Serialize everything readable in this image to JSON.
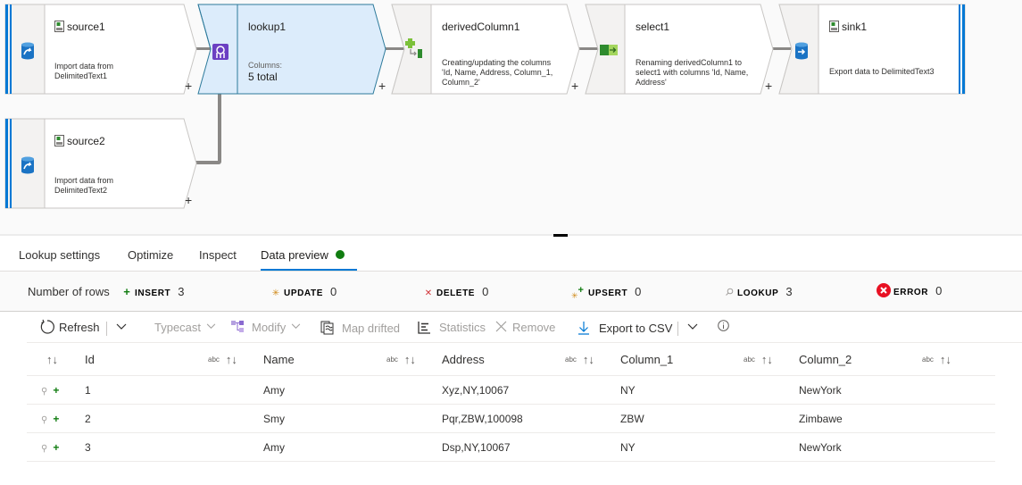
{
  "canvas": {
    "nodes": {
      "source1": {
        "title": "source1",
        "desc": [
          "Import data from",
          "DelimitedText1"
        ],
        "icon": "database-source-icon"
      },
      "lookup1": {
        "title": "lookup1",
        "columns_label": "Columns:",
        "columns_value": "5 total",
        "icon": "lookup-icon"
      },
      "derivedColumn1": {
        "title": "derivedColumn1",
        "desc": [
          "Creating/updating the columns",
          "'Id, Name, Address, Column_1,",
          "Column_2'"
        ],
        "icon": "derived-column-icon"
      },
      "select1": {
        "title": "select1",
        "desc": [
          "Renaming derivedColumn1 to",
          "select1 with columns 'Id, Name,",
          "Address'"
        ],
        "icon": "select-icon"
      },
      "sink1": {
        "title": "sink1",
        "desc": [
          "Export data to DelimitedText3"
        ],
        "icon": "database-sink-icon"
      },
      "source2": {
        "title": "source2",
        "desc": [
          "Import data from",
          "DelimitedText2"
        ],
        "icon": "database-source-icon"
      }
    },
    "add_symbol": "+"
  },
  "tabs": [
    {
      "label": "Lookup settings",
      "active": false
    },
    {
      "label": "Optimize",
      "active": false
    },
    {
      "label": "Inspect",
      "active": false
    },
    {
      "label": "Data preview",
      "active": true,
      "status": "success"
    }
  ],
  "row_counts": {
    "label": "Number of rows",
    "items": [
      {
        "name": "INSERT",
        "value": "3",
        "icon": "+",
        "color": "#107c10"
      },
      {
        "name": "UPDATE",
        "value": "0",
        "icon": "✳",
        "color": "#d08a1a"
      },
      {
        "name": "DELETE",
        "value": "0",
        "icon": "✕",
        "color": "#d13438"
      },
      {
        "name": "UPSERT",
        "value": "0",
        "icon": "✳+",
        "color": "#d08a1a"
      },
      {
        "name": "LOOKUP",
        "value": "3",
        "icon": "⚲",
        "color": "#a19f9d"
      },
      {
        "name": "ERROR",
        "value": "0",
        "icon": "✕",
        "color": "#e81123"
      }
    ]
  },
  "toolbar": {
    "refresh": "Refresh",
    "typecast": "Typecast",
    "modify": "Modify",
    "map_drifted": "Map drifted",
    "statistics": "Statistics",
    "remove": "Remove",
    "export": "Export to CSV"
  },
  "grid": {
    "type_label": "abc",
    "sort_glyph": "↑↓",
    "columns": [
      "Id",
      "Name",
      "Address",
      "Column_1",
      "Column_2"
    ],
    "rows": [
      [
        "1",
        "Amy",
        "Xyz,NY,10067",
        "NY",
        "NewYork"
      ],
      [
        "2",
        "Smy",
        "Pqr,ZBW,100098",
        "ZBW",
        "Zimbawe"
      ],
      [
        "3",
        "Amy",
        "Dsp,NY,10067",
        "NY",
        "NewYork"
      ]
    ]
  },
  "colors": {
    "accent": "#0078d4",
    "selected_node_fill": "#dcecfb",
    "selected_node_border": "#2d7a9b",
    "success": "#107c10"
  }
}
